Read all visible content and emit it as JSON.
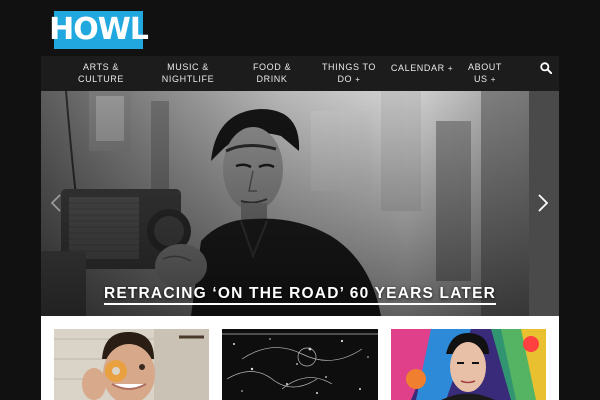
{
  "brand": {
    "logo_text": "HOWL",
    "accent": "#21a8de"
  },
  "nav": {
    "items": [
      {
        "line1": "Arts &",
        "line2": "Culture"
      },
      {
        "line1": "Music &",
        "line2": "Nightlife"
      },
      {
        "line1": "Food &",
        "line2": "Drink"
      },
      {
        "line1": "Things to",
        "line2": "Do",
        "plus": "+"
      },
      {
        "line1": "Calendar",
        "plus": "+"
      },
      {
        "line1": "About",
        "line2": "Us",
        "plus": "+"
      }
    ],
    "search_icon": "search-icon"
  },
  "hero": {
    "title": "Retracing ‘On the Road’ 60 Years Later",
    "prev_icon": "chevron-left-icon",
    "next_icon": "chevron-right-icon"
  },
  "thumbnails": [
    {
      "name": "thumbnail-donut"
    },
    {
      "name": "thumbnail-constellation"
    },
    {
      "name": "thumbnail-pop-art-portrait"
    }
  ]
}
